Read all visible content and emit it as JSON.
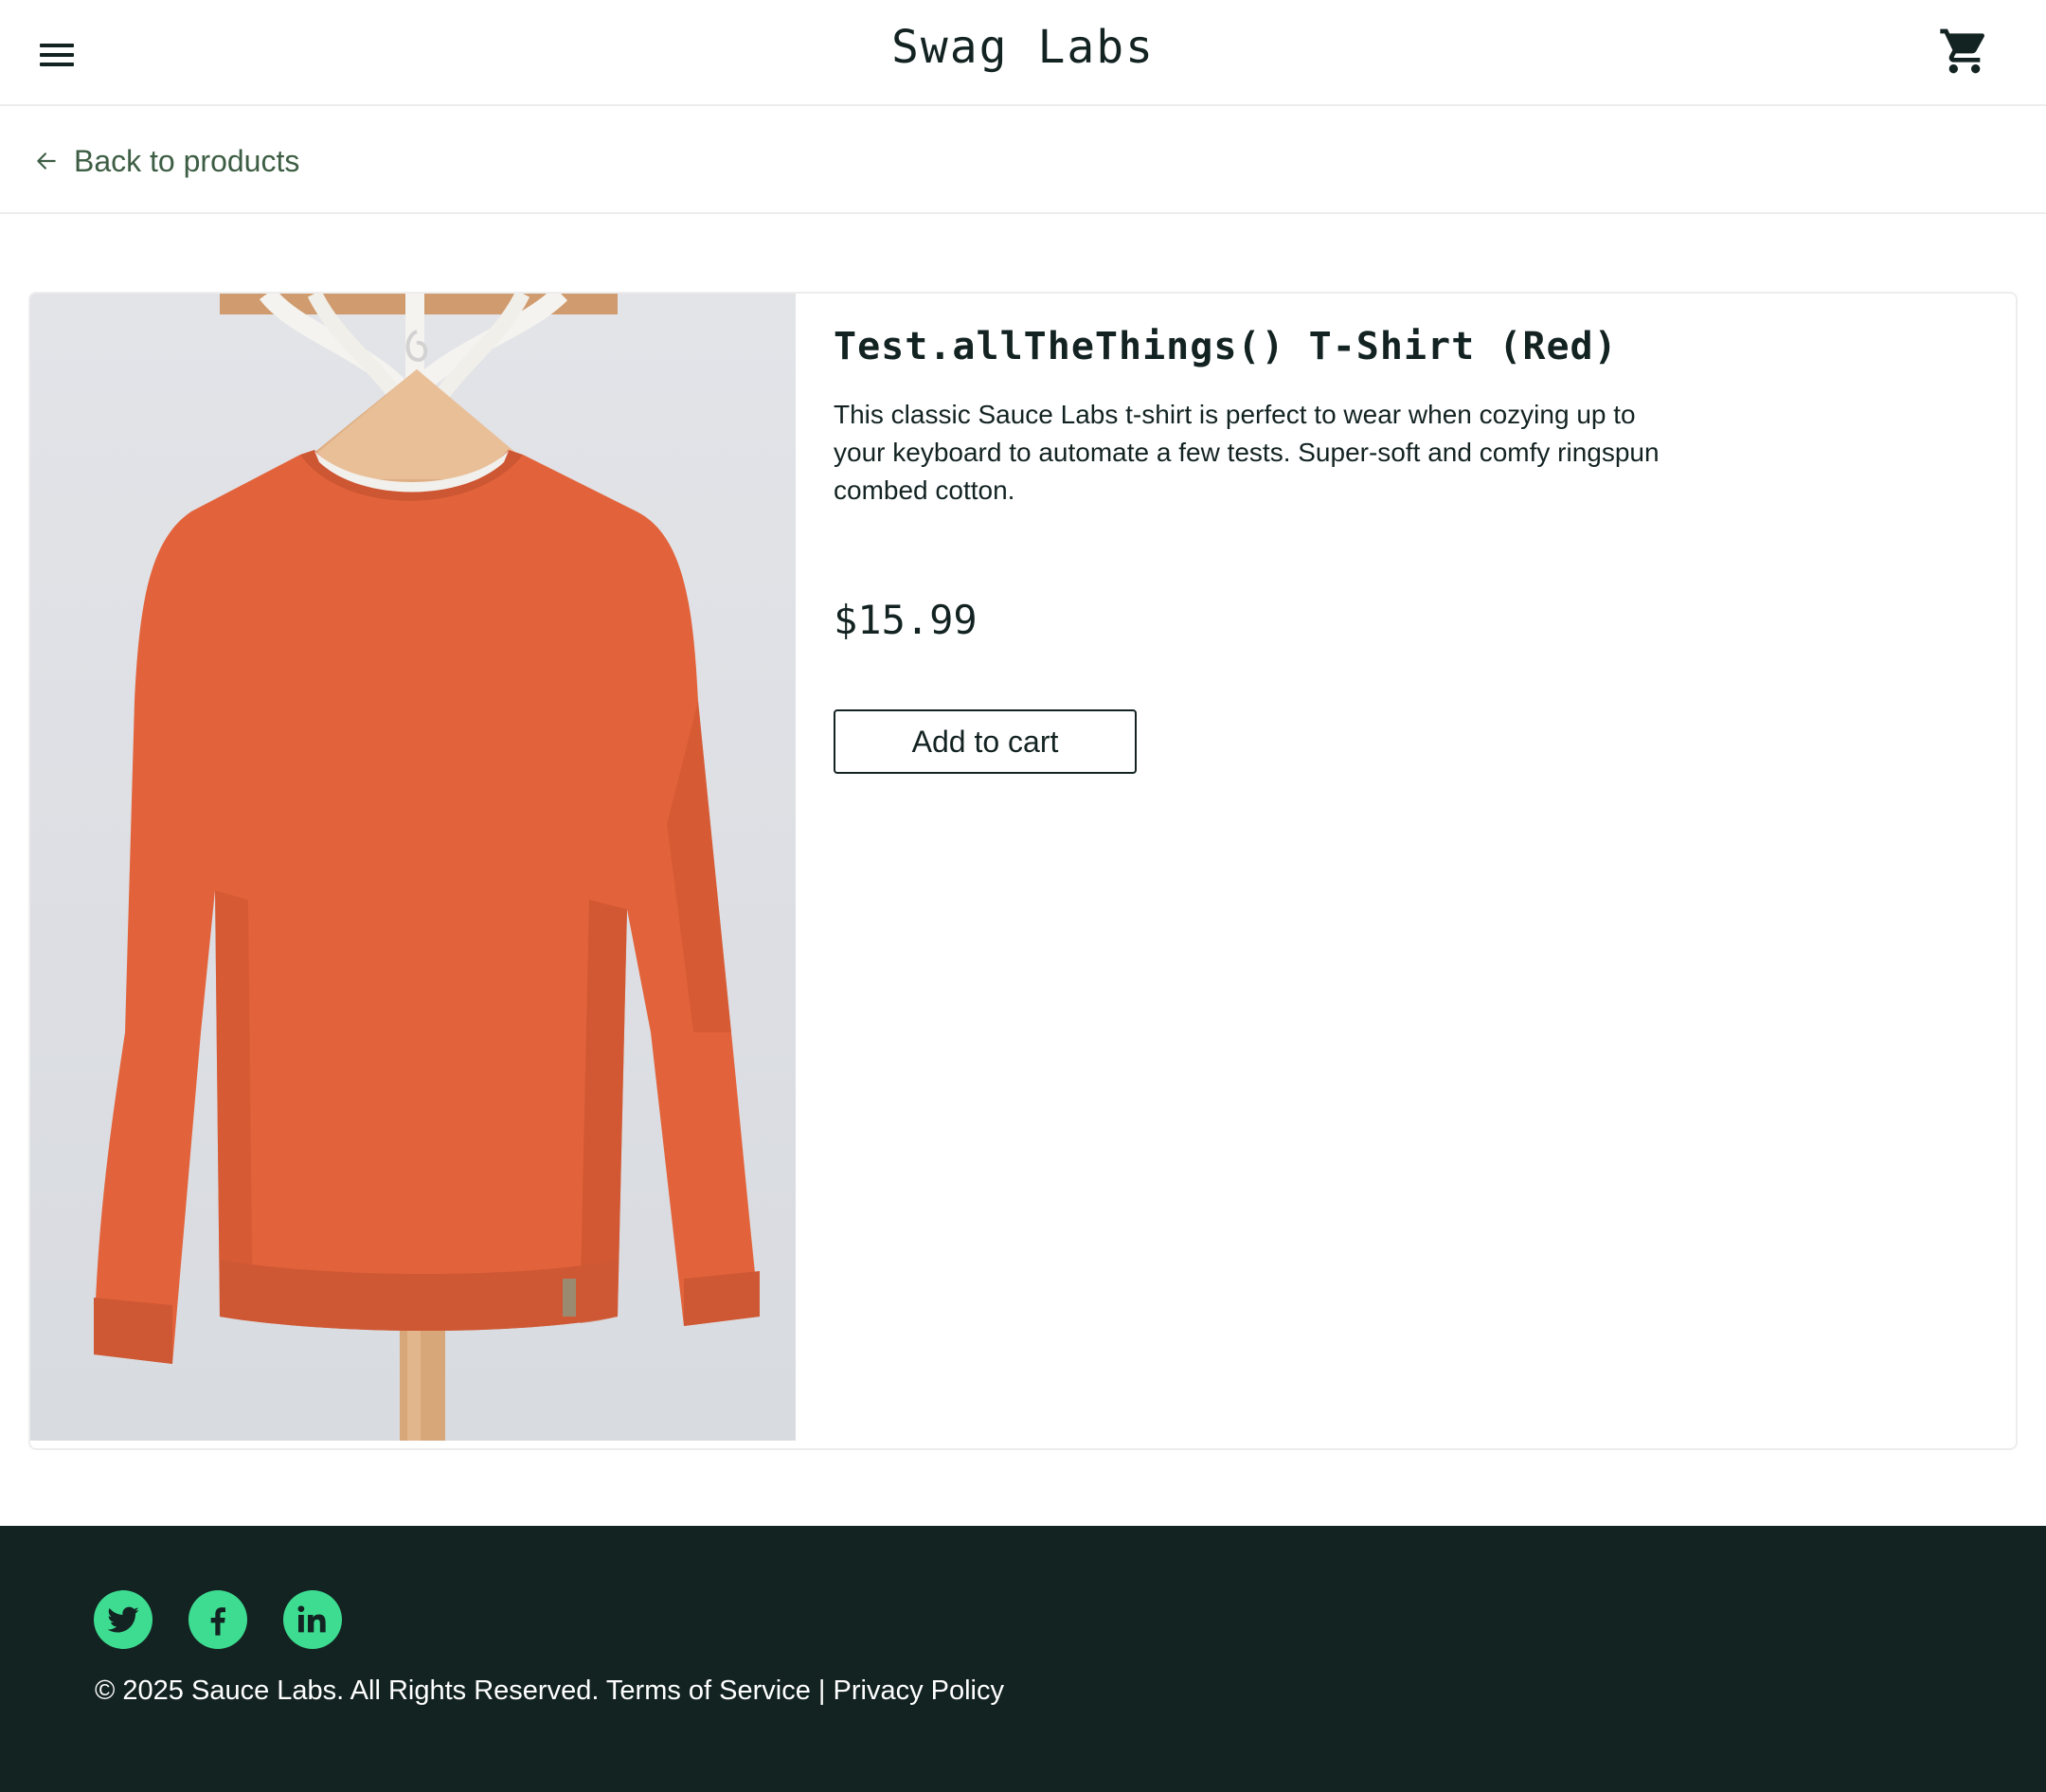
{
  "app": {
    "title": "Swag Labs",
    "menu_icon": "hamburger-menu-icon",
    "cart_icon": "shopping-cart-icon"
  },
  "navigation": {
    "back_label": "Back to products",
    "back_icon": "arrow-left-icon"
  },
  "product": {
    "name": "Test.allTheThings() T-Shirt (Red)",
    "description": "This classic Sauce Labs t-shirt is perfect to wear when cozying up to your keyboard to automate a few tests. Super-soft and comfy ringspun combed cotton.",
    "price": "$15.99",
    "add_to_cart_label": "Add to cart",
    "image": "red-sweatshirt-on-hanger"
  },
  "footer": {
    "social": [
      {
        "name": "twitter",
        "icon": "twitter-icon"
      },
      {
        "name": "facebook",
        "icon": "facebook-icon"
      },
      {
        "name": "linkedin",
        "icon": "linkedin-icon"
      }
    ],
    "copyright": "© 2025 Sauce Labs. All Rights Reserved. Terms of Service | Privacy Policy"
  },
  "colors": {
    "primary_text": "#132322",
    "back_link": "#3d5e44",
    "footer_bg": "#132322",
    "social_icon_bg": "#3ddc91",
    "product_color": "#e2633b"
  }
}
